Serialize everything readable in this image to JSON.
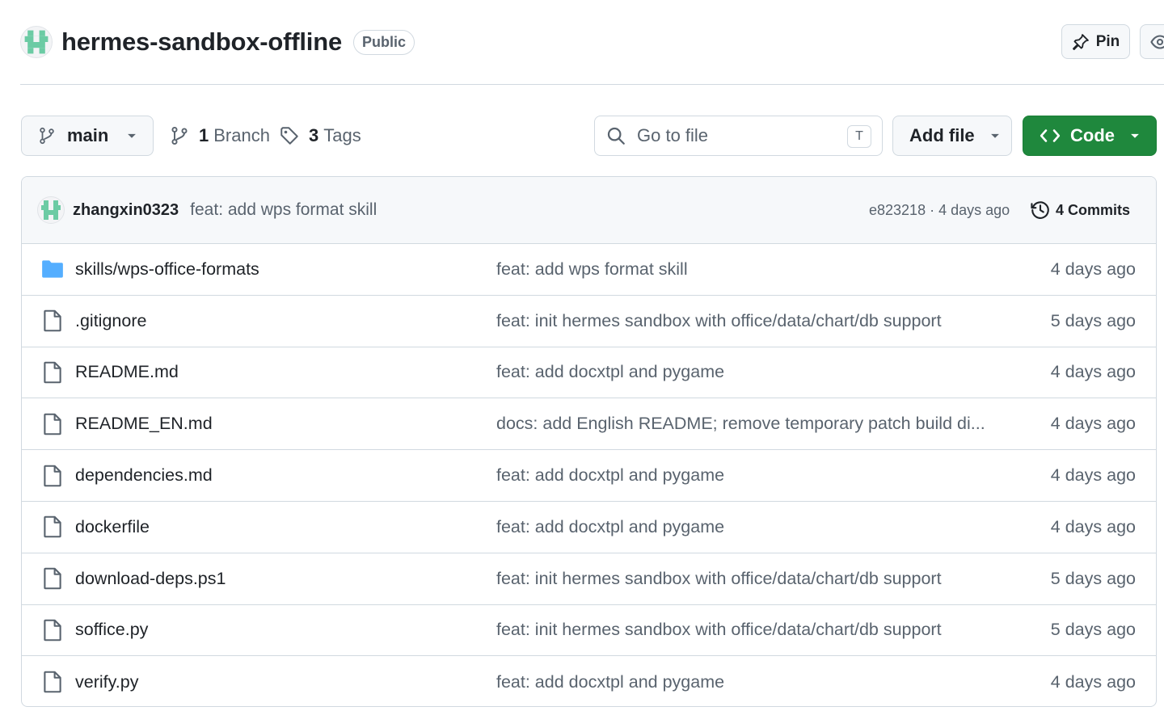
{
  "repo": {
    "name": "hermes-sandbox-offline",
    "visibility": "Public"
  },
  "header_actions": {
    "pin_label": "Pin"
  },
  "toolbar": {
    "branch": "main",
    "branches_count": "1",
    "branches_label": "Branch",
    "tags_count": "3",
    "tags_label": "Tags",
    "search_placeholder": "Go to file",
    "search_shortcut": "T",
    "add_file_label": "Add file",
    "code_label": "Code"
  },
  "latest_commit": {
    "author": "zhangxin0323",
    "message": "feat: add wps format skill",
    "sha_and_age": "e823218 · 4 days ago",
    "commits_label": "4 Commits"
  },
  "files": [
    {
      "type": "folder",
      "name": "skills/wps-office-formats",
      "commit": "feat: add wps format skill",
      "age": "4 days ago"
    },
    {
      "type": "file",
      "name": ".gitignore",
      "commit": "feat: init hermes sandbox with office/data/chart/db support",
      "age": "5 days ago"
    },
    {
      "type": "file",
      "name": "README.md",
      "commit": "feat: add docxtpl and pygame",
      "age": "4 days ago"
    },
    {
      "type": "file",
      "name": "README_EN.md",
      "commit": "docs: add English README; remove temporary patch build di...",
      "age": "4 days ago"
    },
    {
      "type": "file",
      "name": "dependencies.md",
      "commit": "feat: add docxtpl and pygame",
      "age": "4 days ago"
    },
    {
      "type": "file",
      "name": "dockerfile",
      "commit": "feat: add docxtpl and pygame",
      "age": "4 days ago"
    },
    {
      "type": "file",
      "name": "download-deps.ps1",
      "commit": "feat: init hermes sandbox with office/data/chart/db support",
      "age": "5 days ago"
    },
    {
      "type": "file",
      "name": "soffice.py",
      "commit": "feat: init hermes sandbox with office/data/chart/db support",
      "age": "5 days ago"
    },
    {
      "type": "file",
      "name": "verify.py",
      "commit": "feat: add docxtpl and pygame",
      "age": "4 days ago"
    }
  ],
  "colors": {
    "accent_green": "#1f883d",
    "folder_blue": "#54aeff",
    "identicon": "#6ccba4"
  }
}
